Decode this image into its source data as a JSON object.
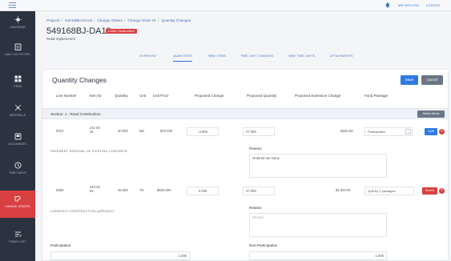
{
  "topbar": {
    "user_label": "MR NGUYEN",
    "logout_label": "LOGOUT"
  },
  "sidebar": {
    "items": [
      {
        "label": "Calendar",
        "icon": "sun-icon"
      },
      {
        "label": "Daily Activities",
        "icon": "clipboard-icon"
      },
      {
        "label": "Items",
        "icon": "grid-icon"
      },
      {
        "label": "Materials",
        "icon": "network-icon"
      },
      {
        "label": "Documents",
        "icon": "document-icon"
      },
      {
        "label": "Time Limits",
        "icon": "clock-icon"
      },
      {
        "label": "Change Orders",
        "icon": "change-icon",
        "active": true
      },
      {
        "label": "Punch List",
        "icon": "list-icon"
      }
    ]
  },
  "breadcrumb": [
    "Projects",
    "549168BJ-DA19",
    "Change Orders",
    "Change Order #1",
    "Quantity Changes"
  ],
  "header": {
    "title": "549168BJ-DA19",
    "badge": "Under Construction",
    "subtitle": "Road replacement"
  },
  "tabs": [
    "Overview",
    "Quantities",
    "New Items",
    "Time Limit Changes",
    "New Time Limits",
    "Attachments"
  ],
  "card": {
    "title": "Quantity Changes",
    "save_label": "Save",
    "cancel_label": "Cancel",
    "columns": [
      "Line Number",
      "Item ID",
      "Quantity",
      "Unit",
      "Unit Price",
      "Proposed Change",
      "Proposed Quantity",
      "Proposed Extension Change",
      "Fund Package"
    ],
    "section": {
      "title": "Section: 1 - Road Construction",
      "select_label": "Select Items"
    },
    "rows": [
      {
        "line": "0010",
        "item_id": "211-0425",
        "quantity": "30.000",
        "unit": "M3",
        "unit_price": "$75.000",
        "proposed_change": "-3.000",
        "proposed_quantity": "27.000",
        "extension_change": "-$225.00",
        "fund_package": "Participation",
        "action_label": "Split",
        "description": "PAVEMENT REMOVAL OF EXISTING CONCRETE",
        "reason_label": "Reason",
        "reason_value": "Ordered too many",
        "reason_placeholder": ""
      },
      {
        "line": "0050",
        "item_id": "310-6255",
        "quantity": "45.000",
        "unit": "TN",
        "unit_price": "$500.000",
        "proposed_change": "2.000",
        "proposed_quantity": "47.000",
        "extension_change": "$1,000.00",
        "fund_package": "Split by 2 packages",
        "action_label": "Revert",
        "description": "CURB/GUT CONSTRUCTION (ASPHALT)",
        "reason_label": "Reason",
        "reason_value": "",
        "reason_placeholder": "Reason"
      }
    ],
    "participation_label": "Participation",
    "participation_value": "1.000",
    "non_participation_label": "Non-Participation",
    "non_participation_value": "1.000"
  },
  "colors": {
    "sidebar": "#2b3341",
    "accent": "#2f7be5",
    "danger": "#d94042",
    "link": "#4a72b8"
  }
}
